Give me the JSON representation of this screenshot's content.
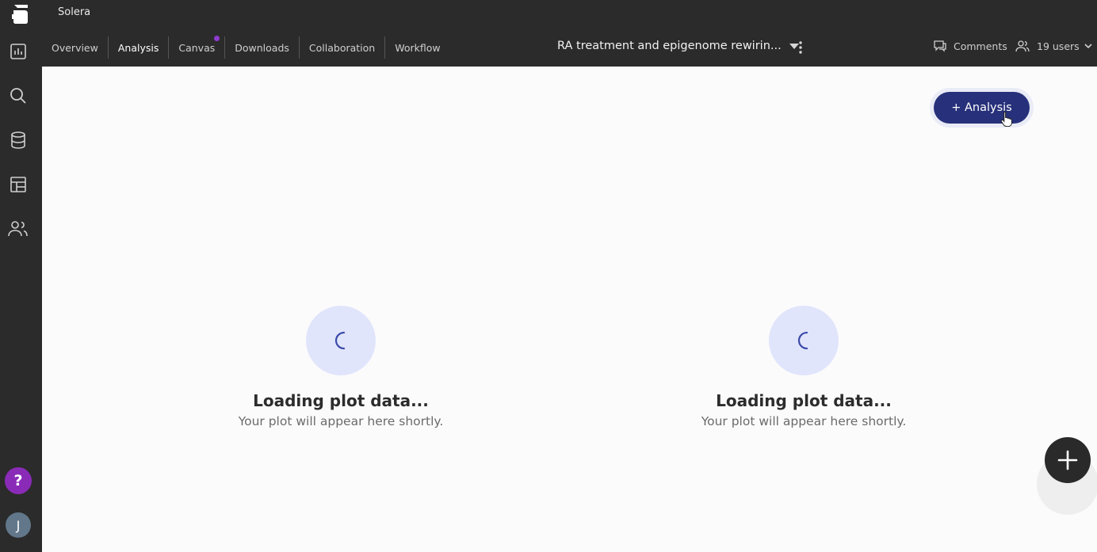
{
  "app": {
    "name": "Solera"
  },
  "tabs": [
    {
      "label": "Overview"
    },
    {
      "label": "Analysis"
    },
    {
      "label": "Canvas"
    },
    {
      "label": "Downloads"
    },
    {
      "label": "Collaboration"
    },
    {
      "label": "Workflow"
    }
  ],
  "active_tab": "Analysis",
  "project": {
    "title": "RA treatment and epigenome rewirin..."
  },
  "header": {
    "comments_label": "Comments",
    "users_label": "19 users"
  },
  "main": {
    "add_button_label": "+ Analysis",
    "loaders": [
      {
        "title": "Loading plot data...",
        "subtitle": "Your plot will appear here shortly."
      },
      {
        "title": "Loading plot data...",
        "subtitle": "Your plot will appear here shortly."
      }
    ]
  },
  "sidebar": {
    "icons": [
      "dashboard-icon",
      "search-icon",
      "database-icon",
      "layout-icon",
      "users-icon"
    ],
    "help_label": "?",
    "avatar_initial": "J"
  },
  "colors": {
    "dark_bg": "#2b2b2b",
    "accent": "#27307a",
    "canvas_dot": "#8e3bd0",
    "help": "#8a2bb8",
    "loader_bg": "#e1e5fb"
  }
}
